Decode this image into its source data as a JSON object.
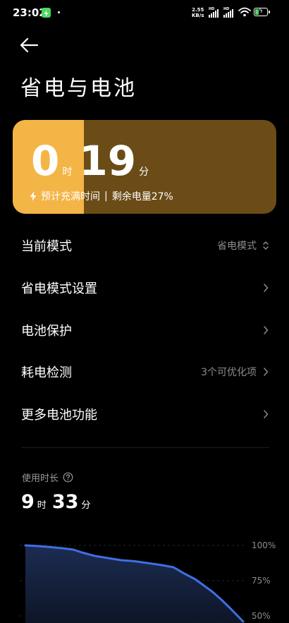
{
  "status_bar": {
    "time": "23:02",
    "speed_value": "2.55",
    "speed_unit": "KB/s",
    "sim1_tag": "HD",
    "sim2_tag": "HD",
    "charging_color": "#4cd964"
  },
  "header": {
    "back_icon": "arrow-left-icon",
    "title": "省电与电池"
  },
  "battery_card": {
    "hours": "0",
    "hours_unit": "时",
    "minutes": "19",
    "minutes_unit": "分",
    "charge_label": "预计充满时间",
    "separator": "|",
    "remaining_label": "剩余电量27%",
    "battery_level_percent": 27,
    "accent_color": "#f4b547",
    "track_color": "#6b4c17"
  },
  "menu": {
    "current_mode": {
      "label": "当前模式",
      "value": "省电模式"
    },
    "power_saving_settings": {
      "label": "省电模式设置"
    },
    "battery_protection": {
      "label": "电池保护"
    },
    "power_detection": {
      "label": "耗电检测",
      "value": "3个可优化项"
    },
    "more_battery": {
      "label": "更多电池功能"
    }
  },
  "usage": {
    "label": "使用时长",
    "hours": "9",
    "hours_unit": "时",
    "minutes": "33",
    "minutes_unit": "分"
  },
  "chart_data": {
    "type": "area",
    "y_ticks": [
      "100%",
      "75%",
      "50%"
    ],
    "ylim": [
      50,
      100
    ],
    "x": [
      0,
      0.05,
      0.1,
      0.17,
      0.22,
      0.26,
      0.32,
      0.38,
      0.44,
      0.5,
      0.56,
      0.62,
      0.68,
      0.73,
      0.78,
      0.82,
      0.86,
      0.9,
      0.94,
      1.0
    ],
    "values": [
      100,
      99.6,
      99,
      98,
      97,
      95,
      92.5,
      91,
      89.5,
      88.8,
      87.5,
      86.2,
      84.5,
      80,
      76,
      71.5,
      67,
      61.5,
      55.5,
      46
    ],
    "line_color": "#3f6fe6"
  }
}
